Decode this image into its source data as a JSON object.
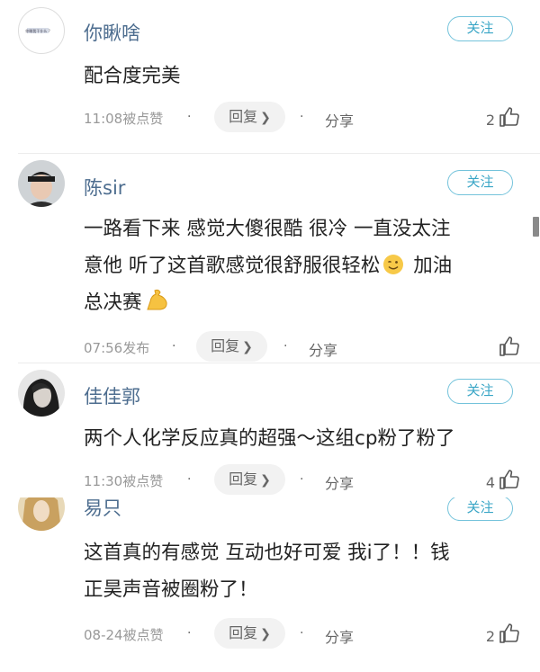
{
  "comments": [
    {
      "username": "你瞅啥",
      "avatar_text": "你瞅我干什么 ?",
      "follow_label": "关注",
      "lines": [
        "配合度完美"
      ],
      "time": "11:08被点赞",
      "reply_label": "回复",
      "share_label": "分享",
      "likes": "2"
    },
    {
      "username": "陈sir",
      "follow_label": "关注",
      "lines": [
        "一路看下来 感觉大傻很酷 很冷 一直没太注",
        "意他 听了这首歌感觉很舒服很轻松",
        "加油",
        "总决赛"
      ],
      "time": "07:56发布",
      "reply_label": "回复",
      "share_label": "分享",
      "likes": ""
    },
    {
      "username": "佳佳郭",
      "follow_label": "关注",
      "lines": [
        "两个人化学反应真的超强～这组cp粉了粉了"
      ],
      "time": "11:30被点赞",
      "reply_label": "回复",
      "share_label": "分享",
      "likes": "4"
    },
    {
      "username": "易只",
      "follow_label": "关注",
      "lines": [
        "这首真的有感觉 互动也好可爱 我i了！！钱",
        "正昊声音被圈粉了！"
      ],
      "time": "08-24被点赞",
      "reply_label": "回复",
      "share_label": "分享",
      "likes": "2"
    }
  ],
  "colors": {
    "username": "#4d6d8f",
    "follow_border": "#74c3db",
    "follow_text": "#3aa6c6",
    "reply_bg": "#f2f2f2"
  },
  "icons": {
    "like": "thumbs-up-icon",
    "reply_chevron": "chevron-right-icon",
    "wink_emoji": "winking-face-emoji",
    "muscle_emoji": "flexed-biceps-emoji"
  }
}
